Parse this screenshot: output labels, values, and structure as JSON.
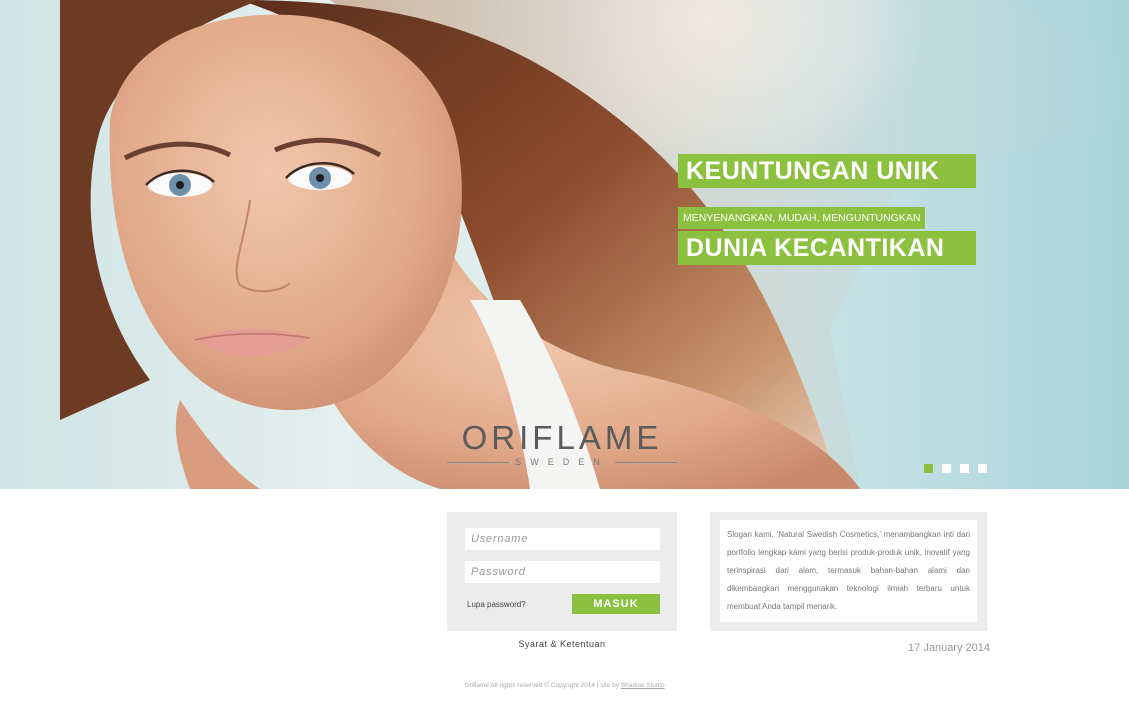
{
  "hero": {
    "headline_top": "KEUNTUNGAN UNIK",
    "subline": "MENYENANGKAN, MUDAH, MENGUNTUNGKAN",
    "headline_bottom": "DUNIA KECANTIKAN",
    "logo": {
      "name": "ORIFLAME",
      "sub": "SWEDEN"
    },
    "slides": {
      "count": 4,
      "active": 0
    },
    "accent_color": "#8bc13f"
  },
  "login": {
    "username_placeholder": "Username",
    "password_placeholder": "Password",
    "forgot_label": "Lupa password?",
    "submit_label": "MASUK",
    "terms_label": "Syarat & Ketentuan"
  },
  "about": {
    "text": "Slogan kami, ‘Natural Swedish Cosmetics,’ menambangkan inti dari portfolio lengkap kami yang berisi produk-produk unik, inovatif yang terinspirasi dari alam, termasuk bahan-bahan alami dan dikembangkan menggunakan teknologi ilmiah terbaru untuk membuat Anda tampil menarik."
  },
  "date": "17 January 2014",
  "footer": {
    "text": "Oriflame All rights reserved © Copyright 2014 | site by",
    "link_label": "Shadow Studio"
  }
}
